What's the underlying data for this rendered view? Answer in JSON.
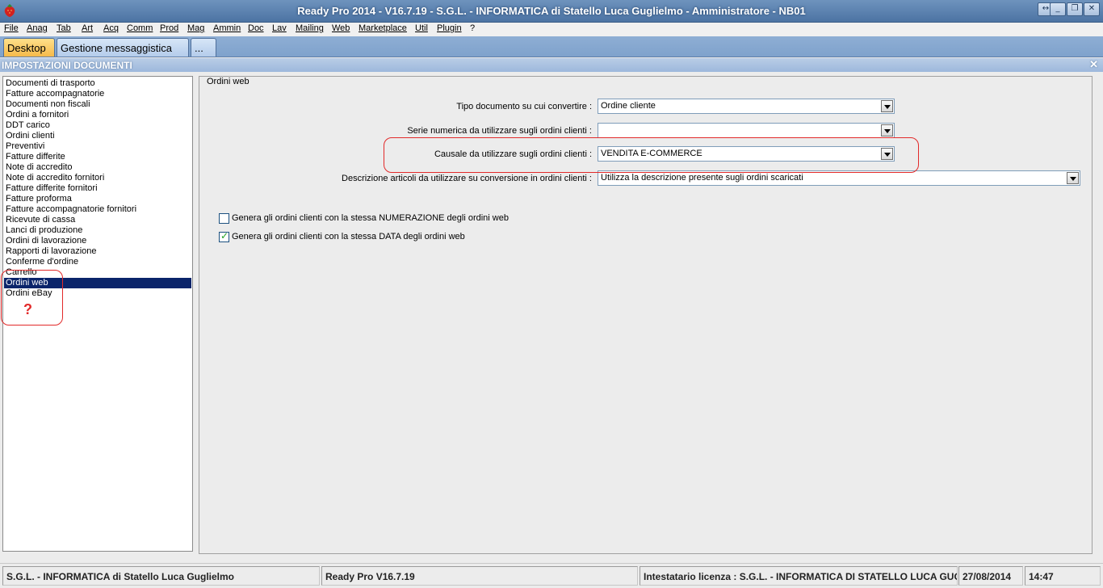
{
  "window": {
    "title": "Ready Pro 2014 - V16.7.19 - S.G.L. - INFORMATICA di Statello Luca Guglielmo - Amministratore - NB01",
    "app_icon": "strawberry-icon",
    "controls": {
      "resize": "↔",
      "minimize": "_",
      "restore": "❐",
      "close": "✕"
    }
  },
  "menu": [
    {
      "label": "File"
    },
    {
      "label": "Anag"
    },
    {
      "label": "Tab"
    },
    {
      "label": "Art"
    },
    {
      "label": "Acq"
    },
    {
      "label": "Comm"
    },
    {
      "label": "Prod"
    },
    {
      "label": "Mag"
    },
    {
      "label": "Ammin"
    },
    {
      "label": "Doc"
    },
    {
      "label": "Lav"
    },
    {
      "label": "Mailing"
    },
    {
      "label": "Web"
    },
    {
      "label": "Marketplace"
    },
    {
      "label": "Util"
    },
    {
      "label": "Plugin"
    },
    {
      "label": "?"
    }
  ],
  "tabs": [
    {
      "label": "Desktop"
    },
    {
      "label": "Gestione messaggistica"
    },
    {
      "label": "..."
    }
  ],
  "section": {
    "title": "IMPOSTAZIONI DOCUMENTI",
    "close": "✕"
  },
  "doc_list": {
    "items": [
      "Documenti di trasporto",
      "Fatture accompagnatorie",
      "Documenti non fiscali",
      "Ordini a fornitori",
      "DDT carico",
      "Ordini clienti",
      "Preventivi",
      "Fatture differite",
      "Note di accredito",
      "Note di accredito fornitori",
      "Fatture differite fornitori",
      "Fatture proforma",
      "Fatture accompagnatorie fornitori",
      "Ricevute di cassa",
      "Lanci di produzione",
      "Ordini di lavorazione",
      "Rapporti di lavorazione",
      "Conferme d'ordine",
      "Carrello",
      "Ordini web",
      "Ordini eBay"
    ],
    "selected": "Ordini web"
  },
  "panel": {
    "group_title": "Ordini web",
    "fields": [
      {
        "label": "Tipo documento su cui convertire :",
        "value": "Ordine cliente"
      },
      {
        "label": "Serie numerica da utilizzare sugli ordini clienti :",
        "value": ""
      },
      {
        "label": "Causale da utilizzare sugli ordini clienti :",
        "value": "VENDITA E-COMMERCE"
      },
      {
        "label": "Descrizione articoli da utilizzare su conversione in ordini clienti :",
        "value": "Utilizza la descrizione presente sugli ordini scaricati"
      }
    ],
    "checkboxes": [
      {
        "label": "Genera gli ordini clienti con la stessa NUMERAZIONE degli ordini web",
        "checked": false
      },
      {
        "label": "Genera gli ordini clienti con la stessa DATA degli ordini web",
        "checked": true
      }
    ]
  },
  "annotation": {
    "question_mark": "?",
    "color": "#e22a2a"
  },
  "statusbar": {
    "company": "S.G.L. - INFORMATICA di Statello Luca Guglielmo",
    "version": "Ready Pro V16.7.19",
    "license": "Intestatario licenza : S.G.L. - INFORMATICA DI STATELLO LUCA GUGLIELMO",
    "date": "27/08/2014",
    "time": "14:47"
  }
}
